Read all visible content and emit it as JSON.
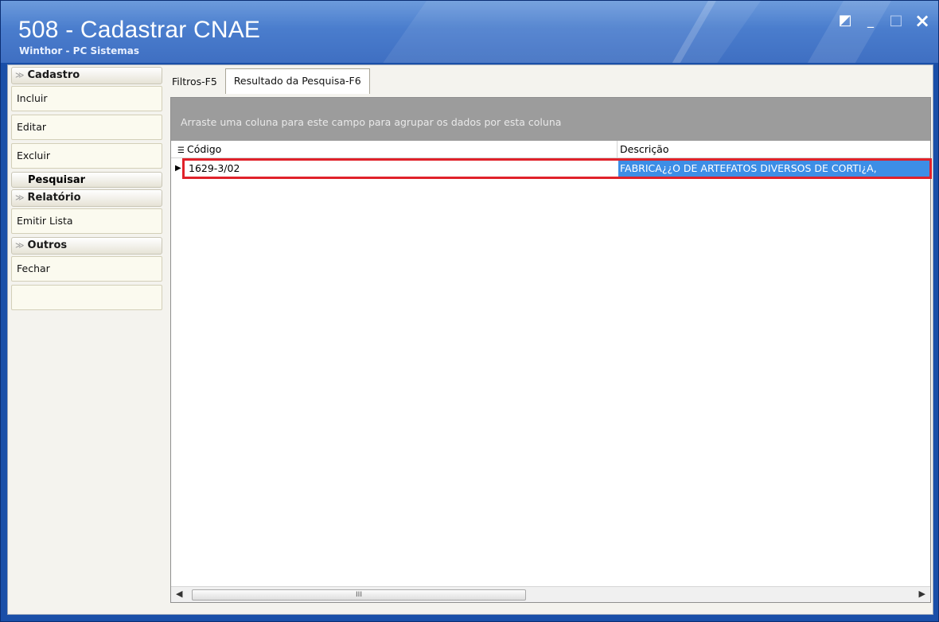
{
  "window": {
    "title": "508 - Cadastrar CNAE",
    "subtitle": "Winthor - PC Sistemas",
    "controls": [
      "restore-icon",
      "minimize-icon",
      "maximize-icon",
      "close-icon"
    ]
  },
  "sidebar": {
    "groups": [
      {
        "label": "Cadastro",
        "items": [
          "Incluir",
          "Editar",
          "Excluir"
        ]
      },
      {
        "label": "Pesquisar"
      },
      {
        "label": "Relatório",
        "items": [
          "Emitir Lista"
        ]
      },
      {
        "label": "Outros",
        "items": [
          "Fechar",
          ""
        ]
      }
    ]
  },
  "tabs": [
    {
      "label": "Filtros-F5",
      "active": false
    },
    {
      "label": "Resultado da Pesquisa-F6",
      "active": true
    }
  ],
  "grid": {
    "group_panel_text": "Arraste uma coluna para este campo para agrupar os dados por esta coluna",
    "columns": [
      "Código",
      "Descrição"
    ],
    "rows": [
      {
        "code": "1629-3/02",
        "description": "FABRICA¿¿O DE ARTEFATOS DIVERSOS DE CORTI¿A,"
      }
    ],
    "scroll_thumb": "III"
  },
  "colors": {
    "title_bar": "#4a7dcd",
    "selection": "#3d8ee6",
    "highlight_border": "#e0212a",
    "group_panel": "#9c9c9c"
  }
}
